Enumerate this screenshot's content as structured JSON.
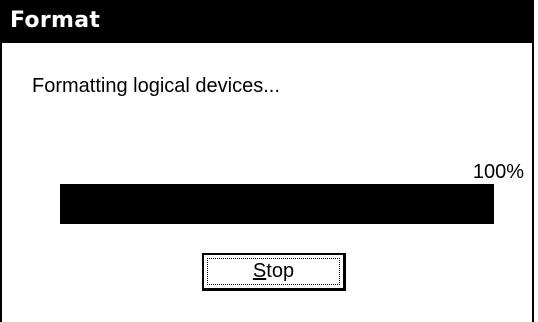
{
  "window": {
    "title": "Format"
  },
  "status": {
    "message": "Formatting logical devices...",
    "percent_label": "100%",
    "progress_fraction": 1.0
  },
  "buttons": {
    "stop": {
      "mnemonic": "S",
      "rest": "top"
    }
  },
  "colors": {
    "title_bar": "#000000",
    "title_text": "#ffffff",
    "progress_fill": "#000000",
    "background": "#ffffff"
  }
}
